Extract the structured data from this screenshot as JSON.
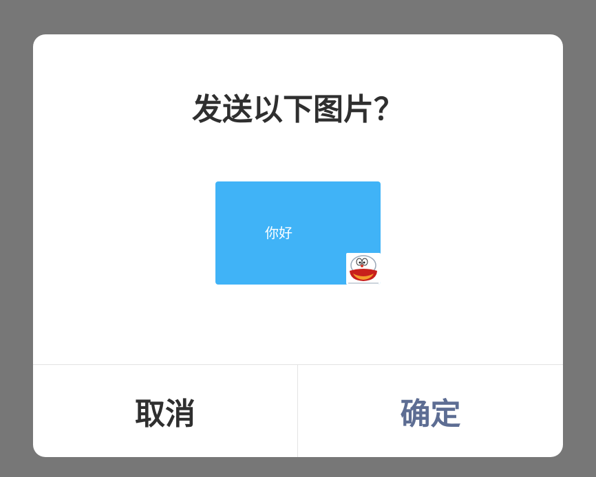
{
  "dialog": {
    "title": "发送以下图片？",
    "preview": {
      "text": "你好",
      "background_color": "#40b3f7",
      "sticker_icon": "doraemon-sticker-icon"
    },
    "buttons": {
      "cancel_label": "取消",
      "confirm_label": "确定"
    },
    "colors": {
      "overlay": "#777777",
      "title": "#2f2f2f",
      "confirm": "#5d6d93"
    }
  }
}
